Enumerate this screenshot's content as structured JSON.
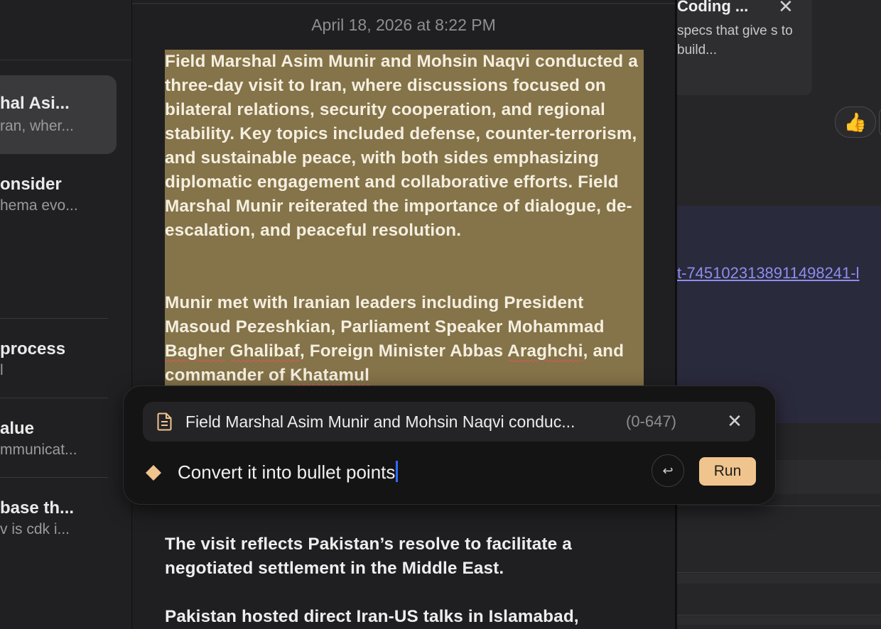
{
  "sidebar": {
    "items": [
      {
        "title": "hal Asi...",
        "snippet": "ran, wher...",
        "selected": true
      },
      {
        "title": "onsider",
        "snippet": "hema evo..."
      },
      {
        "title": "process",
        "snippet": "l"
      },
      {
        "title": "alue",
        "snippet": "mmunicat..."
      },
      {
        "title": "base th...",
        "snippet": "v is cdk i..."
      }
    ]
  },
  "document": {
    "date": "April 18, 2026 at 8:22 PM",
    "highlight_color": "#857349",
    "selected_paragraphs": [
      "Field Marshal Asim Munir and Mohsin Naqvi conducted a three-day visit to Iran, where discussions focused on bilateral relations, security cooperation, and regional stability. Key topics included defense, counter-terrorism, and sustainable peace, with both sides emphasizing diplomatic engagement and collaborative efforts. Field Marshal Munir reiterated the importance of dialogue, de-escalation, and peaceful resolution.",
      {
        "p1": "Munir met with Iranian leaders including President Masoud Pezeshkian, Parliament Speaker Mohammad ",
        "w1": "Bagher",
        "s1": " ",
        "w2": "Ghalibaf",
        "p2": ", Foreign Minister Abbas ",
        "w3": "Araghchi",
        "p3": ", and commander of ",
        "w4": "Khatamul"
      }
    ],
    "paragraphs": [
      "The visit reflects Pakistan’s resolve to facilitate a negotiated settlement in the Middle East.",
      "Pakistan hosted direct Iran-US talks in Islamabad,"
    ]
  },
  "right_pane": {
    "card_title": "Coding ...",
    "card_description": "specs that give s to build...",
    "reaction_emoji": "👍",
    "link_text": "t-7451023138911498241-l"
  },
  "prompt": {
    "context_text": "Field Marshal Asim Munir and Mohsin Naqvi conduc...",
    "context_range": "(0-647)",
    "input_value": "Convert it into bullet points",
    "return_symbol": "↩",
    "run_label": "Run",
    "accent_color": "#f0c48d",
    "caret_color": "#2f6bff",
    "icons": {
      "context": "document-icon",
      "assistant": "diamond-icon",
      "close": "close-icon"
    }
  }
}
